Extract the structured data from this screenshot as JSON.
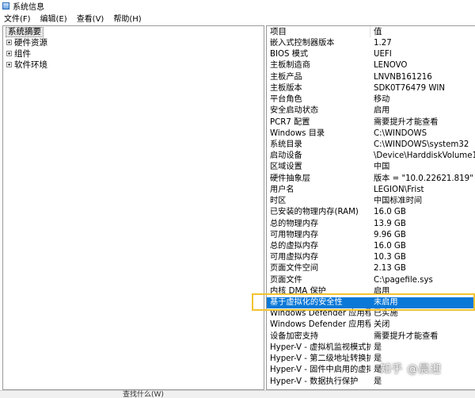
{
  "window": {
    "title": "系统信息"
  },
  "menu": [
    "文件(F)",
    "编辑(E)",
    "查看(V)",
    "帮助(H)"
  ],
  "tree": {
    "root": "系统摘要",
    "items": [
      "硬件资源",
      "组件",
      "软件环境"
    ]
  },
  "table": {
    "headers": {
      "item": "项目",
      "value": "值"
    },
    "rows": [
      {
        "item": "嵌入式控制器版本",
        "value": "1.27"
      },
      {
        "item": "BIOS 模式",
        "value": "UEFI"
      },
      {
        "item": "主板制造商",
        "value": "LENOVO"
      },
      {
        "item": "主板产品",
        "value": "LNVNB161216"
      },
      {
        "item": "主板版本",
        "value": "SDK0T76479 WIN"
      },
      {
        "item": "平台角色",
        "value": "移动"
      },
      {
        "item": "安全启动状态",
        "value": "启用"
      },
      {
        "item": "PCR7 配置",
        "value": "需要提升才能查看"
      },
      {
        "item": "Windows 目录",
        "value": "C:\\WINDOWS"
      },
      {
        "item": "系统目录",
        "value": "C:\\WINDOWS\\system32"
      },
      {
        "item": "启动设备",
        "value": "\\Device\\HarddiskVolume1"
      },
      {
        "item": "区域设置",
        "value": "中国"
      },
      {
        "item": "硬件抽象层",
        "value": "版本 = \"10.0.22621.819\""
      },
      {
        "item": "用户名",
        "value": "LEGION\\Frist"
      },
      {
        "item": "时区",
        "value": "中国标准时间"
      },
      {
        "item": "已安装的物理内存(RAM)",
        "value": "16.0 GB"
      },
      {
        "item": "总的物理内存",
        "value": "13.9 GB"
      },
      {
        "item": "可用物理内存",
        "value": "9.96 GB"
      },
      {
        "item": "总的虚拟内存",
        "value": "16.0 GB"
      },
      {
        "item": "可用虚拟内存",
        "value": "10.3 GB"
      },
      {
        "item": "页面文件空间",
        "value": "2.13 GB"
      },
      {
        "item": "页面文件",
        "value": "C:\\pagefile.sys"
      },
      {
        "item": "内核 DMA 保护",
        "value": "启用"
      },
      {
        "item": "基于虚拟化的安全性",
        "value": "未启用"
      },
      {
        "item": "Windows Defender 应用程序...",
        "value": "已实施"
      },
      {
        "item": "Windows Defender 应用程序...",
        "value": "关闭"
      },
      {
        "item": "设备加密支持",
        "value": "需要提升才能查看"
      },
      {
        "item": "Hyper-V - 虚拟机监视模式扩展",
        "value": "是"
      },
      {
        "item": "Hyper-V - 第二级地址转换扩展",
        "value": "是"
      },
      {
        "item": "Hyper-V - 固件中启用的虚拟化",
        "value": "是"
      },
      {
        "item": "Hyper-V - 数据执行保护",
        "value": "是"
      }
    ],
    "selected_index": 23
  },
  "status": {
    "text": "查找什么(W)"
  },
  "watermark": "知乎 @晨迎",
  "colors": {
    "selection": "#0a78d7",
    "highlight_box": "#f3c331"
  }
}
